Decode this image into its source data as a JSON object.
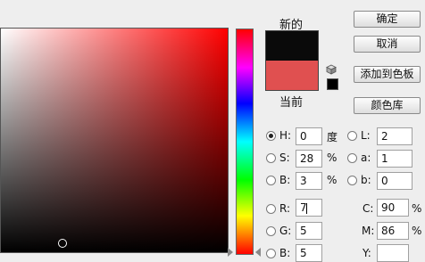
{
  "preview": {
    "new_label": "新的",
    "current_label": "当前",
    "new_color": "#0a0a0a",
    "current_color": "#e05050"
  },
  "buttons": {
    "ok": "确定",
    "cancel": "取消",
    "add_to_swatches": "添加到色板",
    "color_libraries": "颜色库"
  },
  "fields": {
    "H": {
      "label": "H:",
      "value": "0",
      "unit": "度",
      "selected": true
    },
    "S": {
      "label": "S:",
      "value": "28",
      "unit": "%"
    },
    "Bv": {
      "label": "B:",
      "value": "3",
      "unit": "%"
    },
    "R": {
      "label": "R:",
      "value": "7"
    },
    "G": {
      "label": "G:",
      "value": "5"
    },
    "Bb": {
      "label": "B:",
      "value": "5"
    },
    "L": {
      "label": "L:",
      "value": "2"
    },
    "a": {
      "label": "a:",
      "value": "1"
    },
    "b": {
      "label": "b:",
      "value": "0"
    },
    "C": {
      "label": "C:",
      "value": "90",
      "unit": "%"
    },
    "M": {
      "label": "M:",
      "value": "86",
      "unit": "%"
    },
    "Y": {
      "label": "Y:"
    }
  },
  "colors": {
    "field_hue": "#ff0000"
  }
}
